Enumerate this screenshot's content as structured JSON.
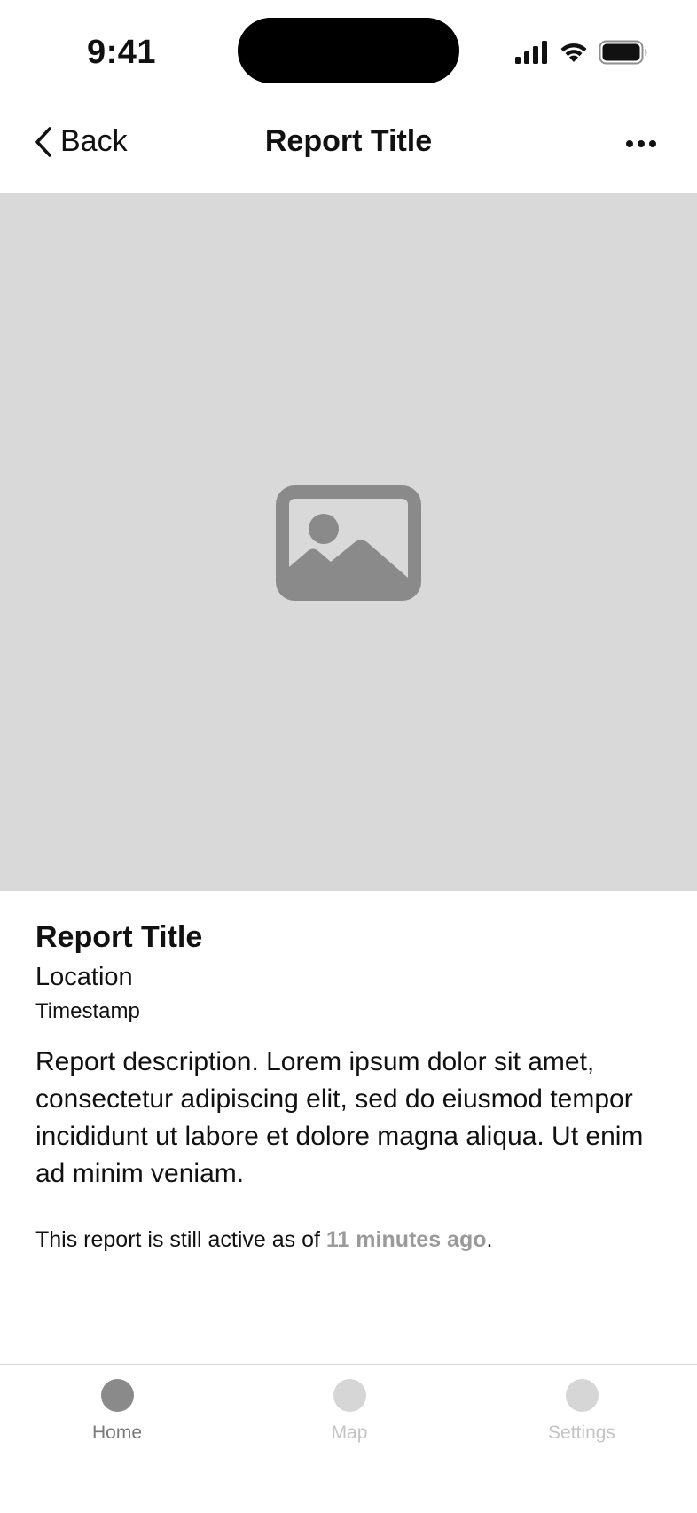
{
  "status_bar": {
    "time": "9:41",
    "icons": [
      "cellular-signal-icon",
      "wifi-icon",
      "battery-icon"
    ]
  },
  "nav": {
    "back_label": "Back",
    "title": "Report Title",
    "more_icon": "ellipsis-icon"
  },
  "hero": {
    "placeholder_icon": "image-placeholder-icon"
  },
  "report": {
    "title": "Report Title",
    "location": "Location",
    "timestamp": "Timestamp",
    "description": "Report description. Lorem ipsum dolor sit amet, consectetur adipiscing elit, sed do eiusmod tempor incididunt ut labore et dolore magna aliqua. Ut enim ad minim veniam.",
    "status_prefix": "This report is still active as of ",
    "status_time": "11 minutes ago",
    "status_suffix": "."
  },
  "tabs": [
    {
      "label": "Home",
      "active": true
    },
    {
      "label": "Map",
      "active": false
    },
    {
      "label": "Settings",
      "active": false
    }
  ],
  "colors": {
    "image_placeholder_bg": "#d9d9d9",
    "placeholder_icon": "#8a8a8a",
    "active_tab": "#8a8a8a",
    "inactive_tab": "#d6d6d6",
    "status_highlight": "#9a9a9a"
  }
}
